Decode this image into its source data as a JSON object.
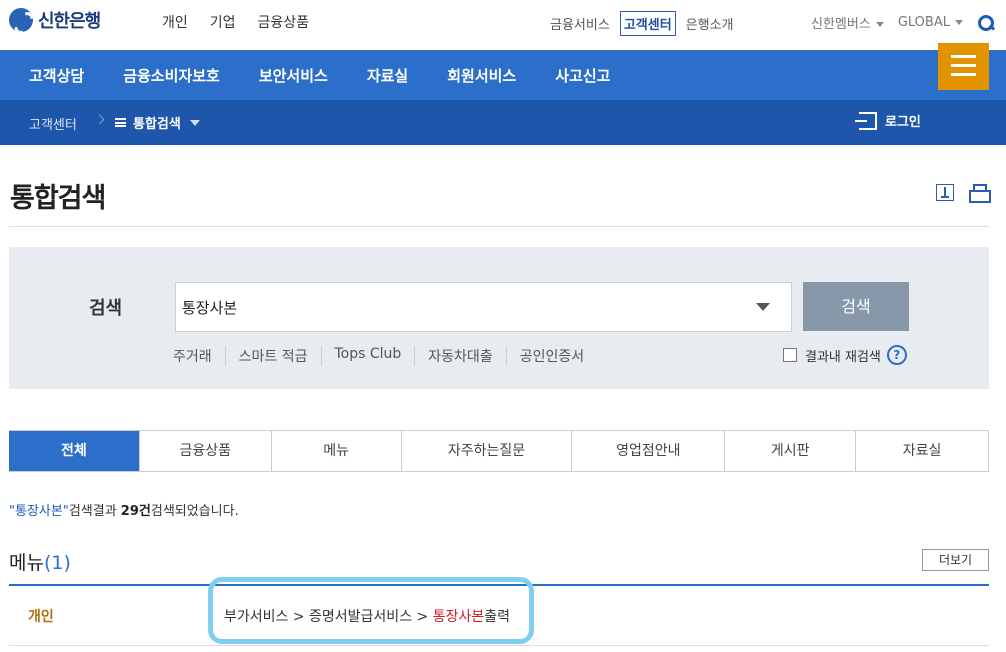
{
  "logo": {
    "text": "신한은행"
  },
  "top_nav": [
    "개인",
    "기업",
    "금융상품"
  ],
  "top_util": {
    "items": [
      "금융서비스",
      "고객센터",
      "은행소개"
    ],
    "active_index": 1
  },
  "top_right": {
    "members": "신한멤버스",
    "global": "GLOBAL"
  },
  "main_nav": [
    "고객상담",
    "금융소비자보호",
    "보안서비스",
    "자료실",
    "회원서비스",
    "사고신고"
  ],
  "breadcrumb": {
    "home": "고객센터",
    "current": "통합검색"
  },
  "login": "로그인",
  "page": {
    "title": "통합검색"
  },
  "search": {
    "label": "검색",
    "value": "통장사본",
    "button": "검색",
    "keywords": [
      "주거래",
      "스마트 적금",
      "Tops Club",
      "자동차대출",
      "공인인증서"
    ],
    "within_results": "결과내 재검색",
    "help": "?"
  },
  "tabs": [
    "전체",
    "금융상품",
    "메뉴",
    "자주하는질문",
    "영업점안내",
    "게시판",
    "자료실"
  ],
  "active_tab": 0,
  "summary": {
    "keyword": "\"통장사본\"",
    "text1": "검색결과 ",
    "count": "29건",
    "text2": "검색되었습니다."
  },
  "section": {
    "title": "메뉴",
    "count": "(1)",
    "more": "더보기"
  },
  "result_row": {
    "category": "개인",
    "path_prefix": "부가서비스 > 증명서발급서비스 > ",
    "path_highlight": "통장사본",
    "path_suffix": "출력"
  },
  "colors": {
    "primary": "#2c6fca",
    "dark_blue": "#1d56aa",
    "accent_orange": "#e19300",
    "annotation": "#7fcfee"
  }
}
